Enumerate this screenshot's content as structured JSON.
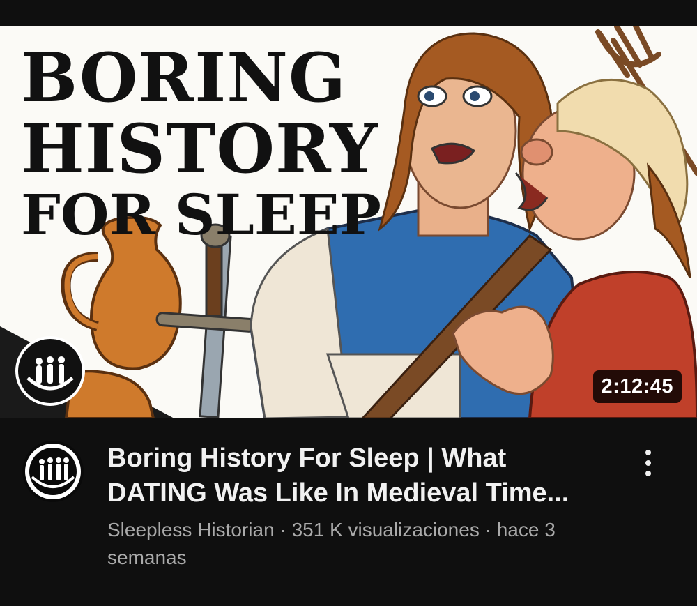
{
  "thumbnail": {
    "title_line1": "BORING",
    "title_line2": "HISTORY",
    "title_line3": "FOR SLEEP",
    "duration": "2:12:45"
  },
  "video": {
    "title": "Boring History For Sleep | What DATING Was Like In Medieval Time...",
    "channel": "Sleepless Historian",
    "separator1": " · ",
    "views": "351 K visualizaciones",
    "separator2": " · ",
    "age": "hace 3 semanas"
  },
  "icons": {
    "avatar": "evolution-silhouettes-icon",
    "more": "more-vertical-icon"
  },
  "colors": {
    "background": "#0f0f0f",
    "title_text": "#f1f1f1",
    "secondary_text": "#aaaaaa"
  }
}
